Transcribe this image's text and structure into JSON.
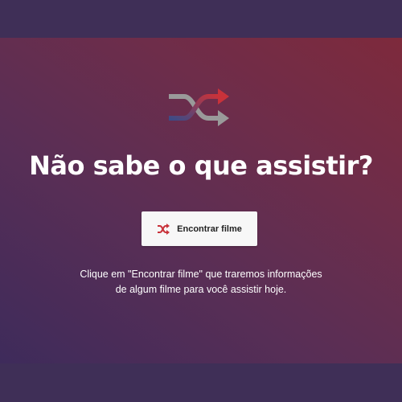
{
  "hero": {
    "icon": "shuffle-icon",
    "title": "Não sabe o que assistir?",
    "button_label": "Encontrar filme",
    "button_icon": "shuffle-icon",
    "description_lines": [
      "Clique em \"Encontrar filme\" que traremos informações",
      "de algum filme para você assistir hoje."
    ]
  },
  "colors": {
    "background": "#3f2f57",
    "gradient_start": "#3e2b5b",
    "gradient_end": "#7e2a3c",
    "icon_red": "#c8323a",
    "icon_blue": "#3c4b86",
    "icon_gray": "#9a9a9a",
    "button_bg": "#f7f7f7"
  }
}
